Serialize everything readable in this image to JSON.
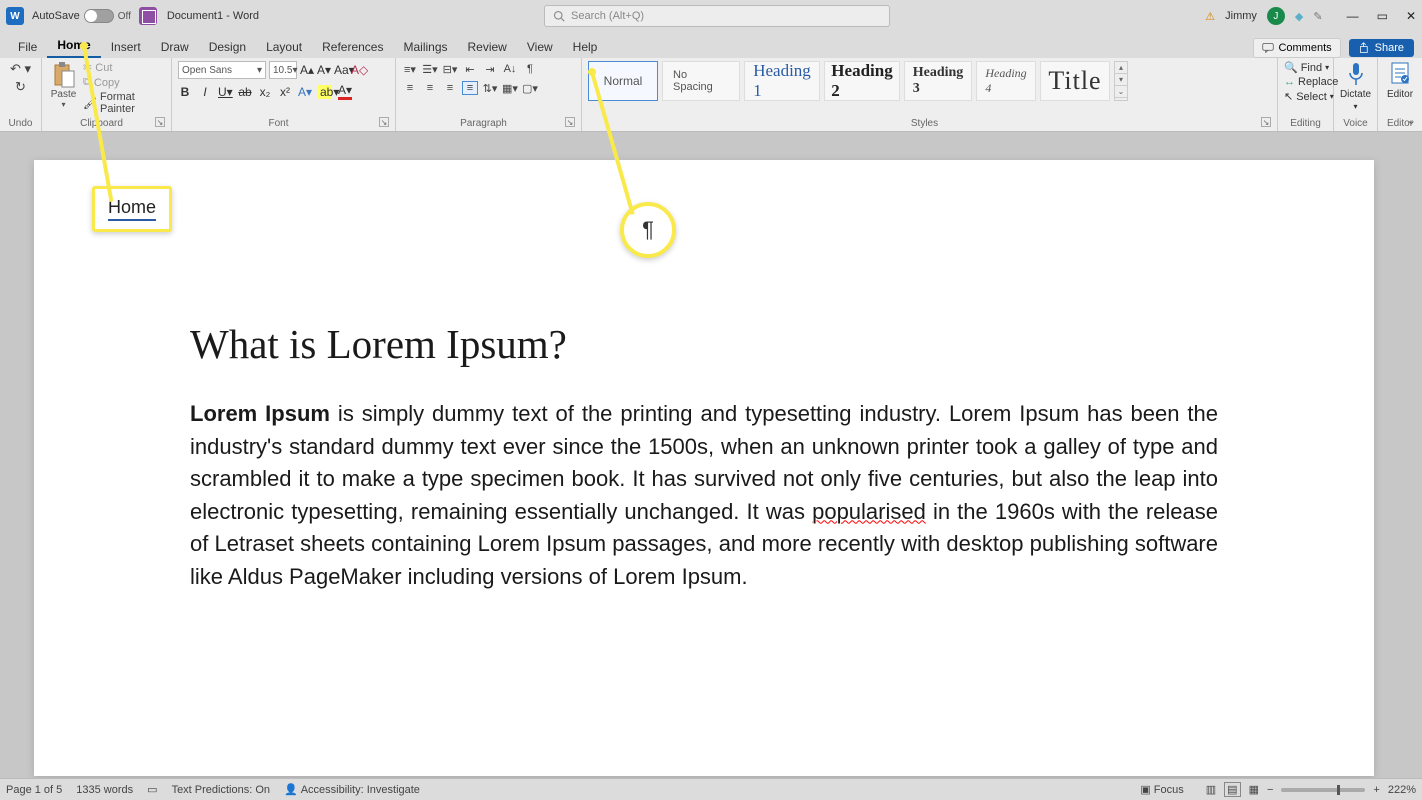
{
  "titlebar": {
    "autosave_label": "AutoSave",
    "autosave_state": "Off",
    "doc_title": "Document1  -  Word",
    "search_placeholder": "Search (Alt+Q)",
    "user_name": "Jimmy",
    "user_initial": "J"
  },
  "tabs": {
    "file": "File",
    "home": "Home",
    "insert": "Insert",
    "draw": "Draw",
    "design": "Design",
    "layout": "Layout",
    "references": "References",
    "mailings": "Mailings",
    "review": "Review",
    "view": "View",
    "help": "Help",
    "comments": "Comments",
    "share": "Share"
  },
  "ribbon": {
    "undo_label": "Undo",
    "clipboard": {
      "paste": "Paste",
      "cut": "Cut",
      "copy": "Copy",
      "format_painter": "Format Painter",
      "label": "Clipboard"
    },
    "font": {
      "name": "Open Sans",
      "size": "10.5",
      "label": "Font"
    },
    "paragraph": {
      "label": "Paragraph"
    },
    "styles": {
      "normal": "Normal",
      "nospacing": "No Spacing",
      "h1": "Heading 1",
      "h2": "Heading 2",
      "h3": "Heading 3",
      "h4": "Heading 4",
      "title": "Title",
      "label": "Styles"
    },
    "editing": {
      "find": "Find",
      "replace": "Replace",
      "select": "Select",
      "label": "Editing"
    },
    "voice": {
      "dictate": "Dictate",
      "label": "Voice"
    },
    "editor": {
      "editor": "Editor",
      "label": "Editor"
    }
  },
  "callouts": {
    "home": "Home",
    "pilcrow": "¶"
  },
  "document": {
    "heading": "What is Lorem Ipsum?",
    "bold_lead": "Lorem Ipsum",
    "p1a": " is simply dummy text of the printing and typesetting industry. Lorem Ipsum has been the industry's standard dummy text ever since the 1500s, when an unknown printer took a galley of type and scrambled it to make a type specimen book. It has survived not only five centuries, but also the leap into electronic typesetting, remaining essentially unchanged. It was ",
    "spell": "popularised",
    "p1b": " in the 1960s with the release of Letraset sheets containing Lorem Ipsum passages, and more recently with desktop publishing software like Aldus PageMaker including versions of Lorem Ipsum."
  },
  "statusbar": {
    "page": "Page 1 of 5",
    "words": "1335 words",
    "predictions": "Text Predictions: On",
    "accessibility": "Accessibility: Investigate",
    "focus": "Focus",
    "zoom": "222%"
  }
}
